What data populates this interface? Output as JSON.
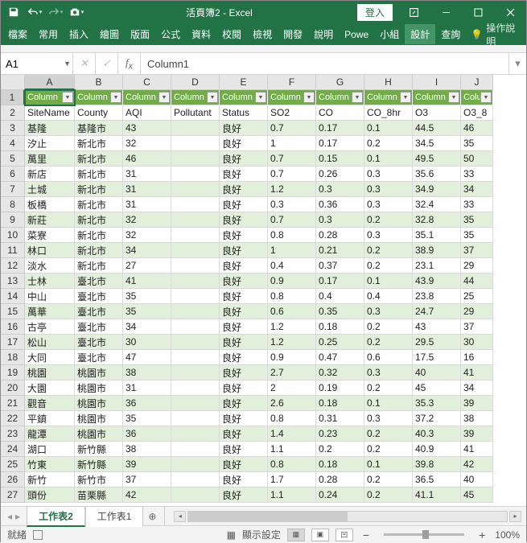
{
  "titlebar": {
    "title": "活頁簿2 - Excel",
    "login": "登入"
  },
  "ribbon": {
    "tabs": [
      "檔案",
      "常用",
      "插入",
      "繪圖",
      "版面",
      "公式",
      "資料",
      "校閱",
      "檢視",
      "開發",
      "說明",
      "Powe",
      "小組",
      "設計",
      "查詢"
    ],
    "active_index": 13,
    "tell_me": "操作說明"
  },
  "namebox": "A1",
  "formula": "Column1",
  "columns": [
    "A",
    "B",
    "C",
    "D",
    "E",
    "F",
    "G",
    "H",
    "I",
    "J"
  ],
  "header_row": [
    "Column",
    "Column",
    "Column",
    "Column",
    "Column",
    "Column",
    "Column",
    "Column",
    "Column",
    "Colu"
  ],
  "rows": [
    [
      "SiteName",
      "County",
      "AQI",
      "Pollutant",
      "Status",
      "SO2",
      "CO",
      "CO_8hr",
      "O3",
      "O3_8"
    ],
    [
      "基隆",
      "基隆市",
      "43",
      "",
      "良好",
      "0.7",
      "0.17",
      "0.1",
      "44.5",
      "46"
    ],
    [
      "汐止",
      "新北市",
      "32",
      "",
      "良好",
      "1",
      "0.17",
      "0.2",
      "34.5",
      "35"
    ],
    [
      "萬里",
      "新北市",
      "46",
      "",
      "良好",
      "0.7",
      "0.15",
      "0.1",
      "49.5",
      "50"
    ],
    [
      "新店",
      "新北市",
      "31",
      "",
      "良好",
      "0.7",
      "0.26",
      "0.3",
      "35.6",
      "33"
    ],
    [
      "土城",
      "新北市",
      "31",
      "",
      "良好",
      "1.2",
      "0.3",
      "0.3",
      "34.9",
      "34"
    ],
    [
      "板橋",
      "新北市",
      "31",
      "",
      "良好",
      "0.3",
      "0.36",
      "0.3",
      "32.4",
      "33"
    ],
    [
      "新莊",
      "新北市",
      "32",
      "",
      "良好",
      "0.7",
      "0.3",
      "0.2",
      "32.8",
      "35"
    ],
    [
      "菜寮",
      "新北市",
      "32",
      "",
      "良好",
      "0.8",
      "0.28",
      "0.3",
      "35.1",
      "35"
    ],
    [
      "林口",
      "新北市",
      "34",
      "",
      "良好",
      "1",
      "0.21",
      "0.2",
      "38.9",
      "37"
    ],
    [
      "淡水",
      "新北市",
      "27",
      "",
      "良好",
      "0.4",
      "0.37",
      "0.2",
      "23.1",
      "29"
    ],
    [
      "士林",
      "臺北市",
      "41",
      "",
      "良好",
      "0.9",
      "0.17",
      "0.1",
      "43.9",
      "44"
    ],
    [
      "中山",
      "臺北市",
      "35",
      "",
      "良好",
      "0.8",
      "0.4",
      "0.4",
      "23.8",
      "25"
    ],
    [
      "萬華",
      "臺北市",
      "35",
      "",
      "良好",
      "0.6",
      "0.35",
      "0.3",
      "24.7",
      "29"
    ],
    [
      "古亭",
      "臺北市",
      "34",
      "",
      "良好",
      "1.2",
      "0.18",
      "0.2",
      "43",
      "37"
    ],
    [
      "松山",
      "臺北市",
      "30",
      "",
      "良好",
      "1.2",
      "0.25",
      "0.2",
      "29.5",
      "30"
    ],
    [
      "大同",
      "臺北市",
      "47",
      "",
      "良好",
      "0.9",
      "0.47",
      "0.6",
      "17.5",
      "16"
    ],
    [
      "桃園",
      "桃園市",
      "38",
      "",
      "良好",
      "2.7",
      "0.32",
      "0.3",
      "40",
      "41"
    ],
    [
      "大園",
      "桃園市",
      "31",
      "",
      "良好",
      "2",
      "0.19",
      "0.2",
      "45",
      "34"
    ],
    [
      "觀音",
      "桃園市",
      "36",
      "",
      "良好",
      "2.6",
      "0.18",
      "0.1",
      "35.3",
      "39"
    ],
    [
      "平鎮",
      "桃園市",
      "35",
      "",
      "良好",
      "0.8",
      "0.31",
      "0.3",
      "37.2",
      "38"
    ],
    [
      "龍潭",
      "桃園市",
      "36",
      "",
      "良好",
      "1.4",
      "0.23",
      "0.2",
      "40.3",
      "39"
    ],
    [
      "湖口",
      "新竹縣",
      "38",
      "",
      "良好",
      "1.1",
      "0.2",
      "0.2",
      "40.9",
      "41"
    ],
    [
      "竹東",
      "新竹縣",
      "39",
      "",
      "良好",
      "0.8",
      "0.18",
      "0.1",
      "39.8",
      "42"
    ],
    [
      "新竹",
      "新竹市",
      "37",
      "",
      "良好",
      "1.7",
      "0.28",
      "0.2",
      "36.5",
      "40"
    ],
    [
      "頭份",
      "苗栗縣",
      "42",
      "",
      "良好",
      "1.1",
      "0.24",
      "0.2",
      "41.1",
      "45"
    ]
  ],
  "sheets": {
    "tabs": [
      "工作表2",
      "工作表1"
    ],
    "active": 0
  },
  "status": {
    "ready": "就緒",
    "display": "顯示設定",
    "zoom": "100%"
  }
}
